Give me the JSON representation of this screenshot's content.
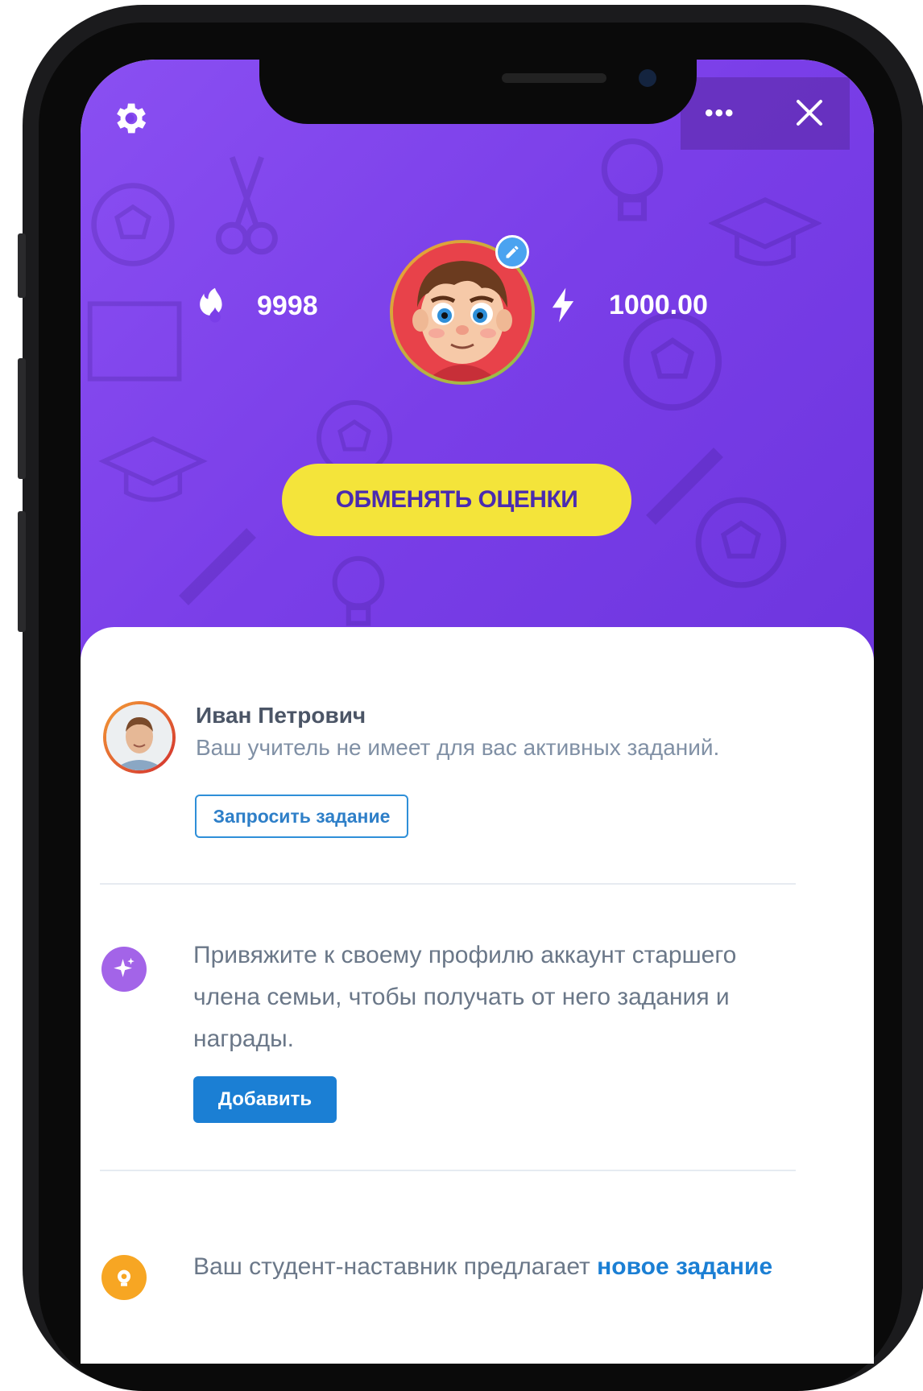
{
  "header": {
    "streak_value": "9998",
    "energy_value": "1000.00",
    "menu_dots": "•••"
  },
  "hero": {
    "exchange_button_label": "ОБМЕНЯТЬ ОЦЕНКИ"
  },
  "teacher": {
    "name": "Иван Петрович",
    "note": "Ваш учитель не имеет для вас активных заданий.",
    "request_button_label": "Запросить задание"
  },
  "family": {
    "text": "Привяжите к своему профилю аккаунт старшего члена семьи, чтобы получать от него задания и награды.",
    "add_button_label": "Добавить"
  },
  "mentor": {
    "text": "Ваш студент-наставник предлагает",
    "link": "новое задание"
  },
  "colors": {
    "hero_purple": "#7a3ee8",
    "exchange_yellow": "#f4e43a",
    "primary_blue": "#1b7fd4",
    "spark_purple": "#a364e8",
    "bulb_orange": "#f7a623"
  },
  "icons": [
    "gear-icon",
    "more-icon",
    "close-icon",
    "fire-icon",
    "lightning-icon",
    "pencil-icon",
    "sparkle-icon",
    "lightbulb-icon"
  ]
}
